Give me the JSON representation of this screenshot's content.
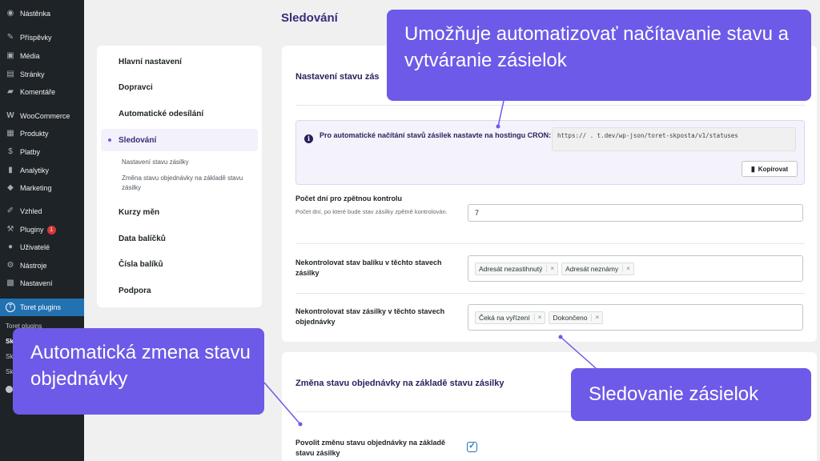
{
  "nav": {
    "items": [
      {
        "icon": "dashboard-icon",
        "glyph": "◉",
        "label": "Nástěnka"
      },
      {
        "icon": "pin-icon",
        "glyph": "✎",
        "label": "Příspěvky"
      },
      {
        "icon": "media-icon",
        "glyph": "▣",
        "label": "Média"
      },
      {
        "icon": "pages-icon",
        "glyph": "▤",
        "label": "Stránky"
      },
      {
        "icon": "comments-icon",
        "glyph": "▰",
        "label": "Komentáře"
      },
      {
        "icon": "woocommerce-icon",
        "glyph": "W",
        "label": "WooCommerce"
      },
      {
        "icon": "products-icon",
        "glyph": "▦",
        "label": "Produkty"
      },
      {
        "icon": "payments-icon",
        "glyph": "$",
        "label": "Platby"
      },
      {
        "icon": "analytics-icon",
        "glyph": "▮",
        "label": "Analytiky"
      },
      {
        "icon": "marketing-icon",
        "glyph": "◆",
        "label": "Marketing"
      },
      {
        "icon": "appearance-icon",
        "glyph": "✐",
        "label": "Vzhled"
      },
      {
        "icon": "plugins-icon",
        "glyph": "⚒",
        "label": "Pluginy",
        "badge": "1"
      },
      {
        "icon": "users-icon",
        "glyph": "●",
        "label": "Uživatelé"
      },
      {
        "icon": "tools-icon",
        "glyph": "⚙",
        "label": "Nástroje"
      },
      {
        "icon": "settings-icon",
        "glyph": "▩",
        "label": "Nastavení"
      },
      {
        "icon": "toret-icon",
        "glyph": "T",
        "label": "Toret plugins"
      }
    ],
    "subitems": [
      "Toret plugins",
      "Sk",
      "Sk",
      "Sk"
    ]
  },
  "page": {
    "title": "Sledování"
  },
  "menu": {
    "items": [
      "Hlavní nastavení",
      "Dopravci",
      "Automatické odesílání",
      "Sledování",
      "Kurzy měn",
      "Data balíčků",
      "Čísla balíků",
      "Podpora"
    ],
    "subitems": [
      "Nastavení stavu zásilky",
      "Změna stavu objednávky na základě stavu zásilky"
    ]
  },
  "tracking": {
    "title": "Nastavení stavu zás",
    "cron_text": "Pro automatické načítání stavů zásilek nastavte na hostingu CRON:",
    "cron_url": "https://            .          t.dev/wp-json/toret-skposta/v1/statuses",
    "copy_label": "Kopírovat",
    "days_label": "Počet dní pro zpětnou kontrolu",
    "days_desc": "Počet dní, po které bude stav zásilky zpětně kontrolován.",
    "days_value": "7",
    "pkg_label": "Nekontrolovat stav balíku v těchto stavech zásilky",
    "pkg_tags": [
      "Adresát nezastihnutý",
      "Adresát neznámy"
    ],
    "order_label": "Nekontrolovat stav zásilky v těchto stavech objednávky",
    "order_tags": [
      "Čeká na vyřízení",
      "Dokončeno"
    ],
    "tag_remove": "×"
  },
  "change": {
    "title": "Změna stavu objednávky na základě stavu zásilky",
    "allow_label": "Povolit změnu stavu objednávky na základě stavu zásilky",
    "allow_checked": true
  },
  "callouts": {
    "automate": "Umožňuje automatizovať načítavanie stavu a vytváranie zásielok",
    "order": "Automatická zmena stavu objednávky",
    "tracking": "Sledovanie zásielok"
  },
  "colors": {
    "accent": "#6d5ae8",
    "wp_sidebar": "#1d2327",
    "wp_active": "#2271b1"
  }
}
